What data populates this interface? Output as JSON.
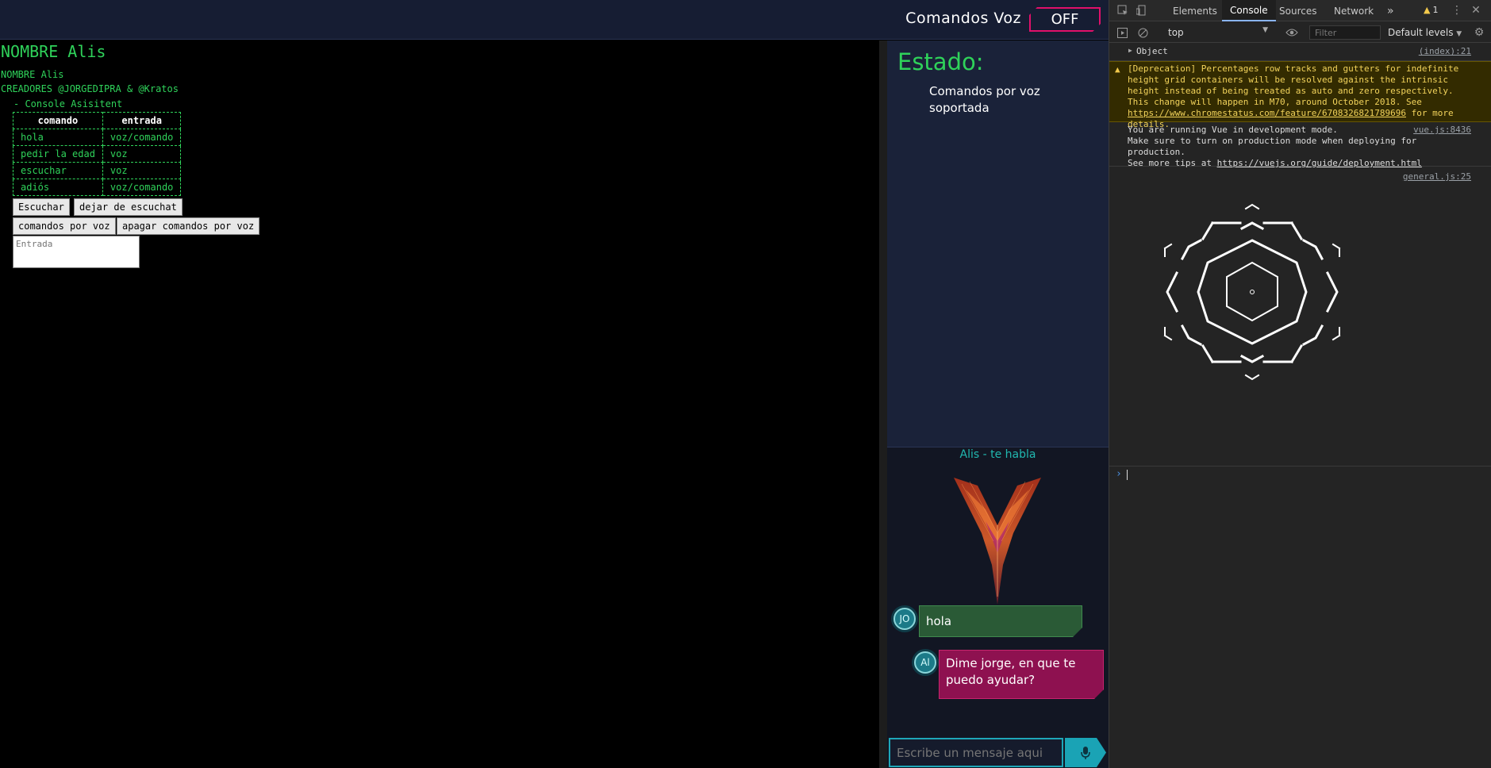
{
  "header": {
    "voice_label": "Comandos Voz",
    "voice_toggle": "OFF",
    "accent_color": "#e0106a"
  },
  "left": {
    "title": "NOMBRE Alis",
    "line_name": "NOMBRE Alis",
    "line_creators": "CREADORES @JORGEDIPRA & @Kratos",
    "console_title": "- Console Asisitent",
    "table": {
      "headers": [
        "comando",
        "entrada"
      ],
      "rows": [
        [
          "hola",
          "voz/comando"
        ],
        [
          "pedir la edad",
          "voz"
        ],
        [
          "escuchar",
          "voz"
        ],
        [
          "adiós",
          "voz/comando"
        ]
      ]
    },
    "buttons": {
      "escuchar": "Escuchar",
      "dejar": "dejar de escuchat",
      "comandos": "comandos por voz",
      "apagar": "apagar comandos por voz"
    },
    "entrada_placeholder": "Entrada",
    "text_color": "#2fd25a"
  },
  "status": {
    "title": "Estado:",
    "text": "Comandos por voz soportada"
  },
  "chat": {
    "title": "Alis - te habla",
    "messages": [
      {
        "avatar": "JO",
        "text": "hola",
        "sender": "user"
      },
      {
        "avatar": "Al",
        "text": "Dime jorge, en que te puedo ayudar?",
        "sender": "bot"
      }
    ],
    "input_placeholder": "Escribe un mensaje aqui",
    "mic_icon": "microphone-icon"
  },
  "devtools": {
    "tabs": [
      "Elements",
      "Console",
      "Sources",
      "Network"
    ],
    "active_tab": "Console",
    "more_tabs": "»",
    "warning_count": "1",
    "context": "top",
    "filter_placeholder": "Filter",
    "levels": "Default levels",
    "logs": {
      "object_label": "Object",
      "object_source": "(index):21",
      "warning_text_1": "[Deprecation] Percentages row tracks and gutters for indefinite height grid containers will be resolved against the intrinsic height instead of being treated as auto and zero respectively. This change will happen in M70, around October 2018. See ",
      "warning_link": "https://www.chromestatus.com/feature/6708326821789696",
      "warning_text_2": " for more details.",
      "vue_text": "You are running Vue in development mode.\nMake sure to turn on production mode when deploying for production.\nSee more tips at ",
      "vue_link": "https://vuejs.org/guide/deployment.html",
      "vue_source": "vue.js:8436",
      "general_source": "general.js:25"
    },
    "prompt_symbol": "›"
  }
}
